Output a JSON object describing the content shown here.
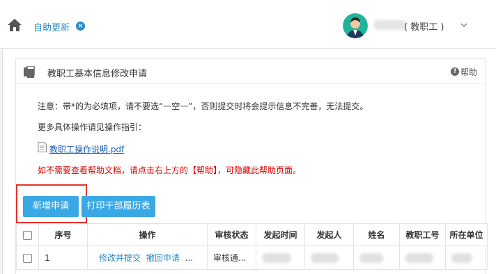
{
  "topbar": {
    "home_icon": "home-icon",
    "tab_label": "自助更新",
    "tab_close_glyph": "×",
    "user_role": "( 教职工 )",
    "user_caret_icon": "chevron-down-icon"
  },
  "panel": {
    "title": "教职工基本信息修改申请",
    "help_label": "帮助",
    "help_glyph": "?",
    "note_required": "注意：带*的为必填项，请不要选“一空一”，否则提交时将会提示信息不完善，无法提交。",
    "note_guide": "更多具体操作请见操作指引：",
    "file_link": "教职工操作说明.pdf",
    "red_tip": "如不需要查看帮助文档，请点击右上方的【帮助】，可隐藏此帮助页面。"
  },
  "toolbar": {
    "add_label": "新增申请",
    "print_label": "打印干部履历表"
  },
  "table": {
    "headers": [
      "序号",
      "操作",
      "审核状态",
      "发起时间",
      "发起人",
      "姓名",
      "教职工号",
      "所在单位"
    ],
    "rows": [
      {
        "index": "1",
        "action_edit": "修改并提交",
        "action_withdraw": "撤回申请",
        "action_more": "...",
        "status": "审核通..."
      }
    ]
  },
  "colors": {
    "accent": "#3aa8e4",
    "link": "#2a8ac7",
    "warning": "#d40000",
    "highlight_border": "#e0352b"
  }
}
